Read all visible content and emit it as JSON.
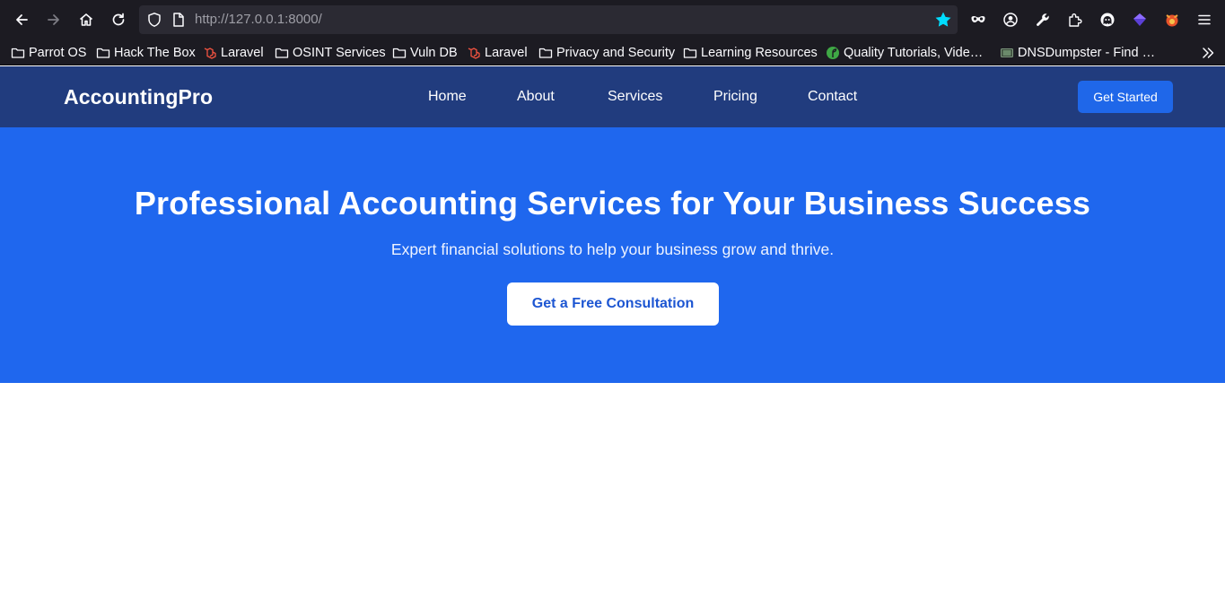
{
  "browser": {
    "url_host": "http://127.0.0.1",
    "url_rest": ":8000/",
    "bookmarks": [
      {
        "label": "Parrot OS",
        "icon": "folder-icon"
      },
      {
        "label": "Hack The Box",
        "icon": "folder-icon"
      },
      {
        "label": "Laravel",
        "icon": "laravel-icon"
      },
      {
        "label": "OSINT Services",
        "icon": "folder-icon"
      },
      {
        "label": "Vuln DB",
        "icon": "folder-icon"
      },
      {
        "label": "Laravel",
        "icon": "laravel-icon"
      },
      {
        "label": "Privacy and Security",
        "icon": "folder-icon"
      },
      {
        "label": "Learning Resources",
        "icon": "folder-icon"
      },
      {
        "label": "Quality Tutorials, Vide…",
        "icon": "green-leaf-icon"
      },
      {
        "label": "DNSDumpster - Find …",
        "icon": "dnsdumpster-icon"
      }
    ]
  },
  "nav": {
    "brand": "AccountingPro",
    "links": [
      "Home",
      "About",
      "Services",
      "Pricing",
      "Contact"
    ],
    "cta": "Get Started"
  },
  "hero": {
    "title": "Professional Accounting Services for Your Business Success",
    "subtitle": "Expert financial solutions to help your business grow and thrive.",
    "button": "Get a Free Consultation"
  },
  "colors": {
    "chrome_bg": "#1c1b22",
    "nav_bg": "#213c7e",
    "hero_bg": "#1f67ee",
    "cta_bg": "#1f67e9",
    "hero_btn_text": "#1d56d2"
  }
}
